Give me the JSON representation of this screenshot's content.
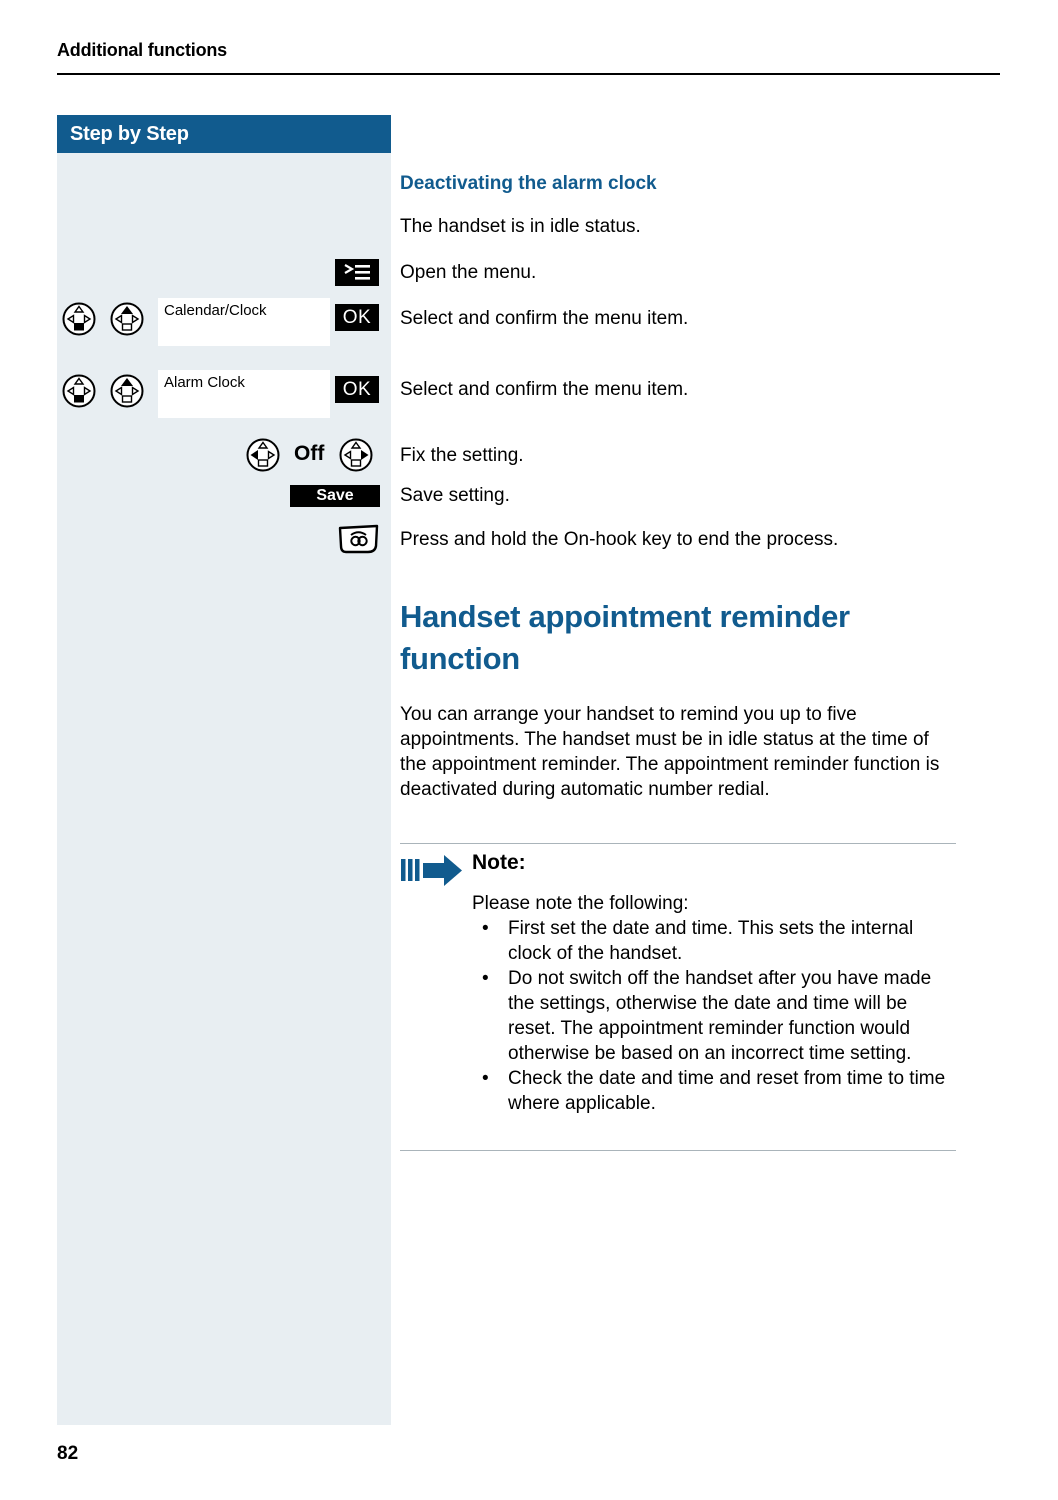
{
  "document": {
    "running_header": "Additional functions",
    "page_number": "82"
  },
  "sidebar": {
    "title": "Step by Step",
    "bg_color": "#e8eef2",
    "header_color": "#115b8e",
    "steps": [
      {
        "id": "open-menu",
        "keys": [
          "menu-key"
        ],
        "display": null,
        "confirm": null,
        "instruction": "Open the menu."
      },
      {
        "id": "select-calendar-clock",
        "keys": [
          "nav-key-down",
          "nav-key-up"
        ],
        "display": "Calendar/Clock",
        "confirm": "OK",
        "instruction": "Select and confirm the menu item."
      },
      {
        "id": "select-alarm-clock",
        "keys": [
          "nav-key-down",
          "nav-key-up"
        ],
        "display": "Alarm Clock",
        "confirm": "OK",
        "instruction": "Select and confirm the menu item."
      },
      {
        "id": "fix-setting",
        "keys": [
          "nav-key-left",
          "nav-key-right"
        ],
        "display": "Off",
        "confirm": null,
        "instruction": "Fix the setting."
      },
      {
        "id": "save-setting",
        "keys": [],
        "display": null,
        "confirm": "Save",
        "instruction": "Save setting."
      },
      {
        "id": "end-process",
        "keys": [
          "on-hook-key"
        ],
        "display": null,
        "confirm": null,
        "instruction": "Press and hold the On-hook key to end the process."
      }
    ],
    "labels": {
      "ok": "OK",
      "save": "Save",
      "off": "Off",
      "calendar_clock": "Calendar/Clock",
      "alarm_clock": "Alarm Clock"
    }
  },
  "content": {
    "section_subheading": "Deactivating the alarm clock",
    "idle_status_line": "The handset is in idle status.",
    "instructions": {
      "open_menu": "Open the menu.",
      "select_confirm_1": "Select and confirm the menu item.",
      "select_confirm_2": "Select and confirm the menu item.",
      "fix_setting": "Fix the setting.",
      "save_setting": "Save setting.",
      "end_process": "Press and hold the On-hook key to end the process."
    },
    "main_heading": "Handset appointment reminder function",
    "paragraph": "You can arrange your handset to remind you up to five appointments. The handset must be in idle status at the time of the appointment reminder. The appointment reminder function is deactivated during automatic number redial.",
    "note": {
      "title": "Note:",
      "lead": "Please note the following:",
      "bullets": [
        "First set the date and time. This sets the internal clock of the handset.",
        "Do not switch off the handset after you have made the settings, otherwise the date and time will be reset. The appointment reminder function would otherwise be based on an incorrect time setting.",
        "Check the date and time and reset from time to time where applicable."
      ],
      "bullet_glyph": "•"
    }
  },
  "colors": {
    "brand_blue": "#115b8e",
    "sidebar_bg": "#e8eef2",
    "text": "#000000"
  }
}
